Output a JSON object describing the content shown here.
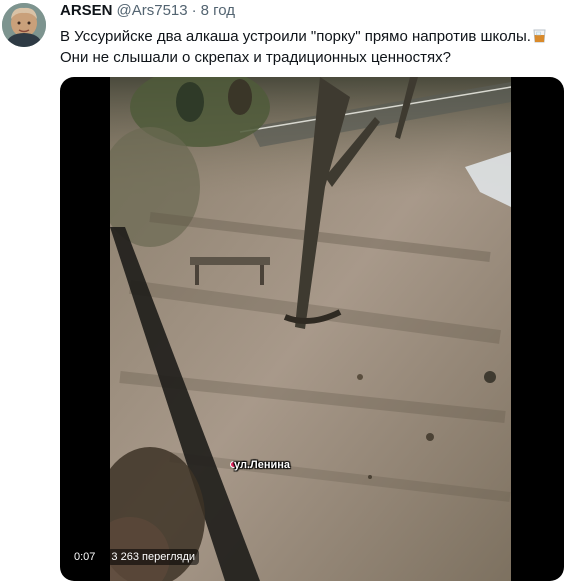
{
  "tweet": {
    "author_name": "ARSEN",
    "author_handle": "@Ars7513",
    "separator": "·",
    "timestamp": "8 год",
    "text_line1": "В Уссурийске два алкаша устроили \"порку\" прямо напротив школы.",
    "text_line2": "Они не слышали о скрепах и традиционных ценностях?",
    "emoji": "tumbler-glass-icon"
  },
  "video": {
    "duration": "0:07",
    "views": "3 263 перегляди",
    "street_label": "ул.Ленина",
    "background_color": "#000000"
  },
  "colors": {
    "text_primary": "#0f1419",
    "text_secondary": "#536471"
  }
}
